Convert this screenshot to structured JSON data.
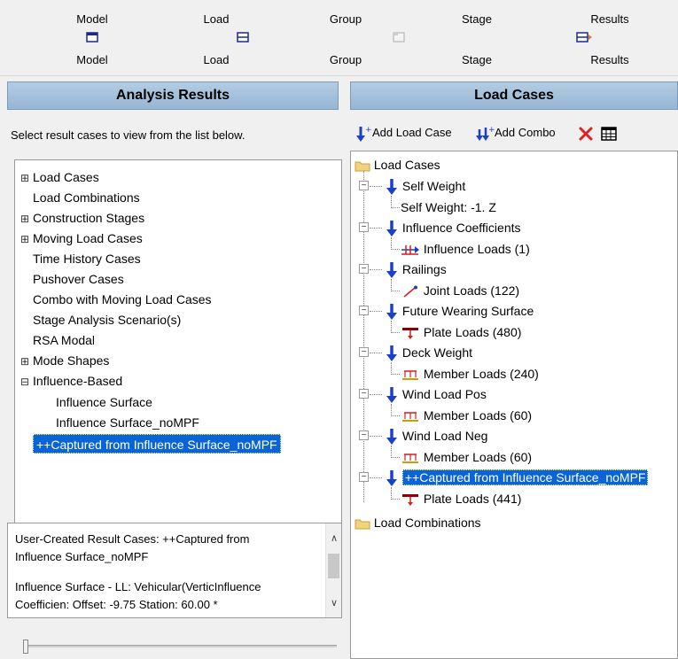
{
  "toolbar": {
    "items": [
      {
        "top": "Model",
        "bottom": "Model",
        "icon": "model-icon"
      },
      {
        "top": "Load",
        "bottom": "Load",
        "icon": "load-icon"
      },
      {
        "top": "Group",
        "bottom": "Group",
        "icon": "group-icon"
      },
      {
        "top": "Stage",
        "bottom": "Stage",
        "icon": "stage-icon"
      },
      {
        "top": "Results",
        "bottom": "Results",
        "icon": "results-icon"
      }
    ]
  },
  "left": {
    "header": "Analysis Results",
    "instructions": "Select result cases to view from the list below.",
    "items": [
      {
        "label": "Load Cases",
        "expander": "⊞"
      },
      {
        "label": "Load Combinations",
        "expander": ""
      },
      {
        "label": "Construction Stages",
        "expander": "⊞"
      },
      {
        "label": "Moving Load Cases",
        "expander": "⊞"
      },
      {
        "label": "Time History Cases",
        "expander": ""
      },
      {
        "label": "Pushover Cases",
        "expander": ""
      },
      {
        "label": "Combo with Moving Load Cases",
        "expander": ""
      },
      {
        "label": "Stage Analysis Scenario(s)",
        "expander": ""
      },
      {
        "label": "RSA Modal",
        "expander": ""
      },
      {
        "label": "Mode Shapes",
        "expander": "⊞"
      },
      {
        "label": "Influence-Based",
        "expander": "⊟"
      },
      {
        "label": "Influence Surface",
        "expander": ""
      },
      {
        "label": "Influence Surface_noMPF",
        "expander": ""
      },
      {
        "label": "++Captured from Influence Surface_noMPF",
        "expander": ""
      }
    ],
    "description": {
      "line1": "User-Created Result Cases: ++Captured from",
      "line2": "Influence Surface_noMPF",
      "line3": "Influence Surface - LL: Vehicular(VerticInfluence",
      "line4": "Coefficien: Offset: -9.75 Station: 60.00 *"
    }
  },
  "right": {
    "header": "Load Cases",
    "toolbar": {
      "add_load_case": "Add Load Case",
      "add_combo": "Add Combo"
    },
    "tree": {
      "root": "Load Cases",
      "cases": [
        {
          "name": "Self Weight",
          "child": "Self Weight: -1. Z",
          "child_icon": "none"
        },
        {
          "name": "Influence Coefficients",
          "child": "Influence Loads (1)",
          "child_icon": "influence-load-icon"
        },
        {
          "name": "Railings",
          "child": "Joint Loads (122)",
          "child_icon": "joint-load-icon"
        },
        {
          "name": "Future Wearing Surface",
          "child": "Plate Loads (480)",
          "child_icon": "plate-load-icon"
        },
        {
          "name": "Deck Weight",
          "child": "Member Loads (240)",
          "child_icon": "member-load-icon"
        },
        {
          "name": "Wind Load Pos",
          "child": "Member Loads (60)",
          "child_icon": "member-load-icon"
        },
        {
          "name": "Wind Load Neg",
          "child": "Member Loads (60)",
          "child_icon": "member-load-icon"
        },
        {
          "name": "++Captured from Influence Surface_noMPF",
          "child": "Plate Loads (441)",
          "child_icon": "plate-load-icon"
        }
      ],
      "combos": "Load Combinations"
    }
  },
  "colors": {
    "header_gradient_top": "#b4cce2",
    "header_gradient_bottom": "#96b6d4",
    "selection": "#0a64d6",
    "load_arrow": "#1a3fc9",
    "member_load": "#d21f1f",
    "plate_load": "#8b0000"
  }
}
